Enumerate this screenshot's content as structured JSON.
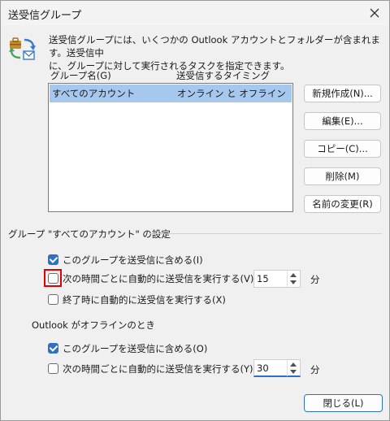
{
  "window": {
    "title": "送受信グループ",
    "intro_line1": "送受信グループには、いくつかの Outlook アカウントとフォルダーが含まれます。送受信中",
    "intro_line2": "に、グループに対して実行されるタスクを指定できます。"
  },
  "list": {
    "col_group": "グループ名(G)",
    "col_timing": "送受信するタイミング",
    "rows": [
      {
        "group": "すべてのアカウント",
        "timing": "オンライン と オフライン",
        "selected": true
      }
    ]
  },
  "buttons": {
    "new": "新規作成(N)...",
    "edit": "編集(E)...",
    "copy": "コピー(C)...",
    "delete": "削除(M)",
    "rename": "名前の変更(R)",
    "close": "閉じる(L)"
  },
  "settings": {
    "group_title": "グループ \"すべてのアカウント\" の設定",
    "online": {
      "include_label": "このグループを送受信に含める(I)",
      "include_checked": true,
      "auto_label": "次の時間ごとに自動的に送受信を実行する(V)",
      "auto_checked": false,
      "auto_minutes": "15",
      "minutes_unit": "分",
      "on_exit_label": "終了時に自動的に送受信を実行する(X)",
      "on_exit_checked": false
    },
    "offline": {
      "section_label": "Outlook がオフラインのとき",
      "include_label": "このグループを送受信に含める(O)",
      "include_checked": true,
      "auto_label": "次の時間ごとに自動的に送受信を実行する(Y)",
      "auto_checked": false,
      "auto_minutes": "30",
      "minutes_unit": "分"
    }
  },
  "icons": {
    "close": "close-icon",
    "send_receive": "send-receive-icon"
  },
  "colors": {
    "accent": "#2f6fc6",
    "selection": "#a6c8ee",
    "highlight_ring": "#e00000"
  }
}
